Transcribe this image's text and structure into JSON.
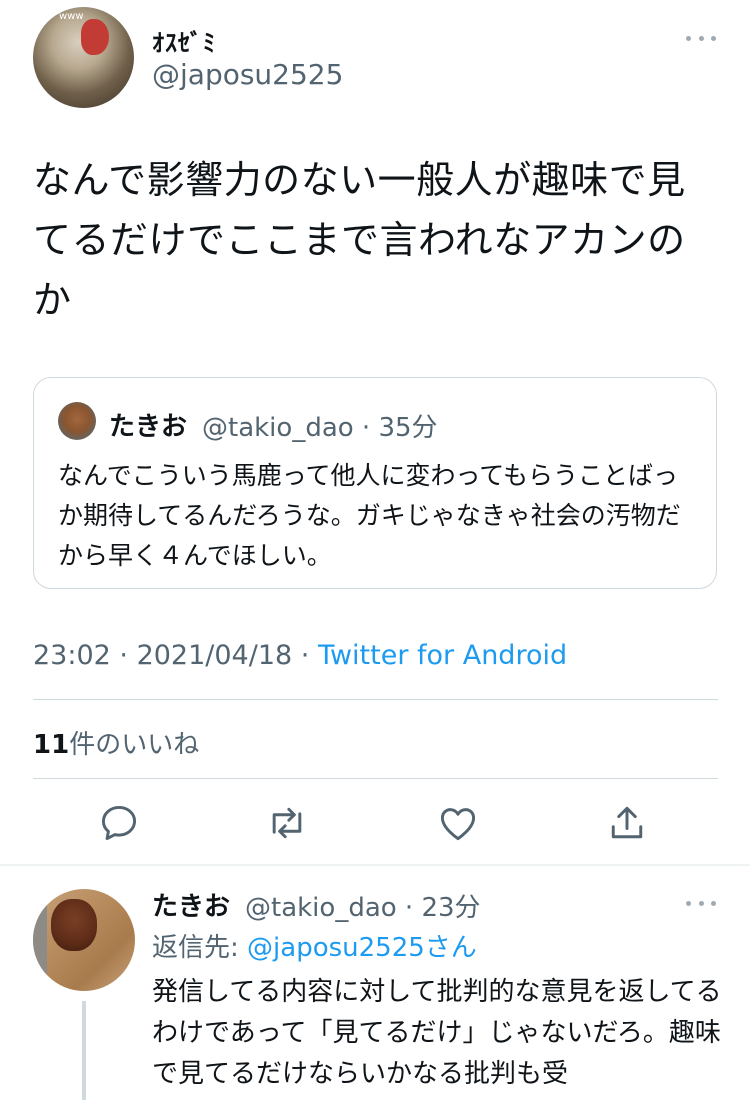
{
  "tweet": {
    "author": {
      "display_name": "ｵｽｾﾞﾐ",
      "handle": "@japosu2525",
      "avatar_watermark": "www"
    },
    "text": "なんで影響力のない一般人が趣味で見てるだけでここまで言われなアカンのか",
    "quote": {
      "name": "たきお",
      "handle": "@takio_dao",
      "time": "35分",
      "text": "なんでこういう馬鹿って他人に変わってもらうことばっか期待してるんだろうな。ガキじゃなきゃ社会の汚物だから早く４んでほしい。"
    },
    "time": "23:02",
    "date": "2021/04/18",
    "source": "Twitter for Android",
    "likes": {
      "count": "11",
      "label": "件のいいね"
    },
    "actions": {
      "reply_icon": "reply-icon",
      "retweet_icon": "retweet-icon",
      "like_icon": "heart-icon",
      "share_icon": "share-icon"
    }
  },
  "reply": {
    "name": "たきお",
    "handle": "@takio_dao",
    "time": "23分",
    "reply_to_label": "返信先:",
    "reply_to_handle": "@japosu2525さん",
    "text": "発信してる内容に対して批判的な意見を返してるわけであって「見てるだけ」じゃないだろ。趣味で見てるだけならいかなる批判も受"
  },
  "colors": {
    "link": "#1d9bf0",
    "secondary_text": "#536471",
    "primary_text": "#0f1419",
    "border": "#cfd9de"
  }
}
